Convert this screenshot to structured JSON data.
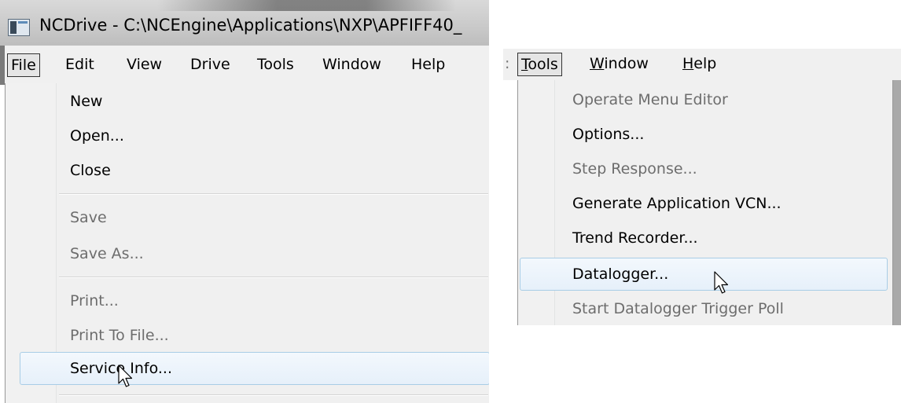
{
  "left": {
    "window_title": "NCDrive - C:\\NCEngine\\Applications\\NXP\\APFIFF40_",
    "menubar": [
      "File",
      "Edit",
      "View",
      "Drive",
      "Tools",
      "Window",
      "Help"
    ],
    "active_menu": "File",
    "file_menu": {
      "group1": [
        "New",
        "Open...",
        "Close"
      ],
      "group2": [
        "Save",
        "Save As..."
      ],
      "group3": [
        "Print...",
        "Print To File...",
        "Service Info..."
      ]
    },
    "disabled_items": [
      "Save",
      "Save As...",
      "Print...",
      "Print To File..."
    ],
    "highlighted_item": "Service Info..."
  },
  "right": {
    "menubar_prefix": ":",
    "menubar": [
      {
        "prefix": "",
        "underlined": "T",
        "rest": "ools"
      },
      {
        "prefix": "",
        "underlined": "W",
        "rest": "indow"
      },
      {
        "prefix": "",
        "underlined": "H",
        "rest": "elp"
      }
    ],
    "active_menu": "Tools",
    "tools_menu": [
      "Operate Menu Editor",
      "Options...",
      "Step Response...",
      "Generate Application VCN...",
      "Trend Recorder...",
      "Datalogger...",
      "Start Datalogger Trigger Poll"
    ],
    "disabled_items": [
      "Operate Menu Editor",
      "Step Response...",
      "Start Datalogger Trigger Poll"
    ],
    "highlighted_item": "Datalogger..."
  },
  "icons": {
    "app_icon": "ncdrive-app-icon",
    "pointer": "mouse-pointer-icon"
  },
  "colors": {
    "menu_bg": "#f0f0f0",
    "highlight_border": "#a8cde6",
    "disabled_text": "#6d6d6d",
    "title_bar": "#c9c9c9"
  }
}
